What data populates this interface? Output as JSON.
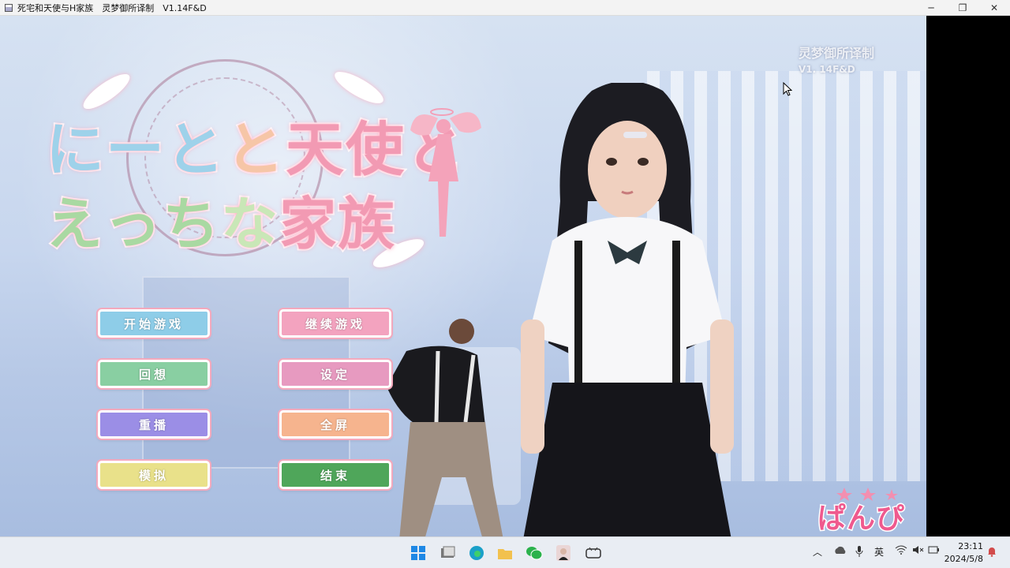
{
  "window": {
    "title": "死宅和天使与H家族　灵梦御所译制　V1.14F&D",
    "controls": {
      "minimize": "─",
      "maximize": "❐",
      "close": "✕"
    }
  },
  "game": {
    "logo": {
      "line1": [
        "に",
        "ー",
        "と",
        "と",
        "天使",
        "と"
      ],
      "line2": [
        "え",
        "っ",
        "ち",
        "な",
        "家族"
      ]
    },
    "watermark": {
      "translator": "灵梦御所译制",
      "version": "V1. 14F&D"
    },
    "menu": [
      {
        "id": "start",
        "label": "开始游戏",
        "color": "#8ecde8"
      },
      {
        "id": "continue",
        "label": "继续游戏",
        "color": "#f3a3bf"
      },
      {
        "id": "recall",
        "label": "回想",
        "color": "#89cfa2"
      },
      {
        "id": "settings",
        "label": "设定",
        "color": "#e79ac0"
      },
      {
        "id": "replay",
        "label": "重播",
        "color": "#9b8ee6"
      },
      {
        "id": "gallery",
        "label": "全屏",
        "color": "#f6b48e"
      },
      {
        "id": "extra",
        "label": "模拟",
        "color": "#e9e18a"
      },
      {
        "id": "exit",
        "label": "结束",
        "color": "#4fa65a"
      }
    ],
    "brand": "ぱんぴ"
  },
  "taskbar": {
    "apps": [
      "windows-start",
      "file-explorer",
      "edge",
      "folder",
      "wechat",
      "photo-app",
      "game-app"
    ],
    "tray": {
      "chevron": "︿",
      "ime": "英",
      "time": "23:11",
      "date": "2024/5/8"
    }
  }
}
